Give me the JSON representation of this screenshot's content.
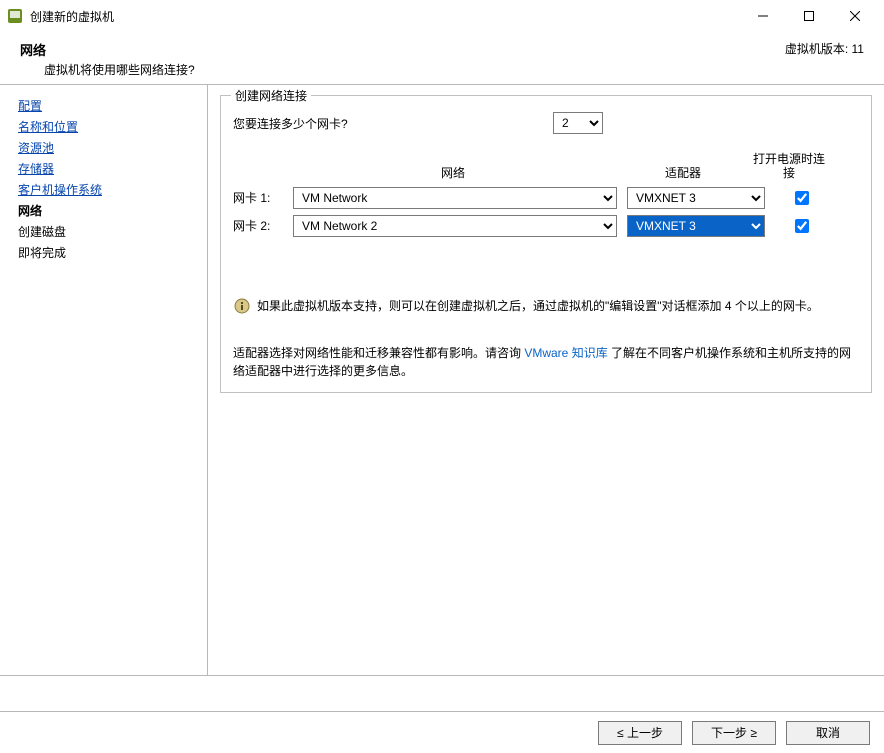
{
  "titlebar": {
    "title": "创建新的虚拟机"
  },
  "header": {
    "title": "网络",
    "subtitle": "虚拟机将使用哪些网络连接?",
    "version": "虚拟机版本: 11"
  },
  "sidebar": {
    "items": [
      {
        "label": "配置",
        "kind": "link"
      },
      {
        "label": "名称和位置",
        "kind": "link"
      },
      {
        "label": "资源池",
        "kind": "link"
      },
      {
        "label": "存储器",
        "kind": "link"
      },
      {
        "label": "客户机操作系统",
        "kind": "link"
      },
      {
        "label": "网络",
        "kind": "current"
      },
      {
        "label": "创建磁盘",
        "kind": "plain"
      },
      {
        "label": "即将完成",
        "kind": "plain"
      }
    ]
  },
  "group": {
    "legend": "创建网络连接",
    "question": "您要连接多少个网卡?",
    "nic_count": "2",
    "headers": {
      "network": "网络",
      "adapter": "适配器",
      "connect": "打开电源时连接"
    },
    "nics": [
      {
        "label": "网卡 1:",
        "network": "VM Network",
        "adapter": "VMXNET 3",
        "connect": true,
        "hl": false
      },
      {
        "label": "网卡 2:",
        "network": "VM Network 2",
        "adapter": "VMXNET 3",
        "connect": true,
        "hl": true
      }
    ],
    "info1": "如果此虚拟机版本支持，则可以在创建虚拟机之后，通过虚拟机的\"编辑设置\"对话框添加 4 个以上的网卡。",
    "info2a": "适配器选择对网络性能和迁移兼容性都有影响。请咨询 ",
    "kb_link": "VMware 知识库",
    "info2b": " 了解在不同客户机操作系统和主机所支持的网络适配器中进行选择的更多信息。"
  },
  "buttons": {
    "back": "≤ 上一步",
    "next": "下一步 ≥",
    "cancel": "取消"
  }
}
